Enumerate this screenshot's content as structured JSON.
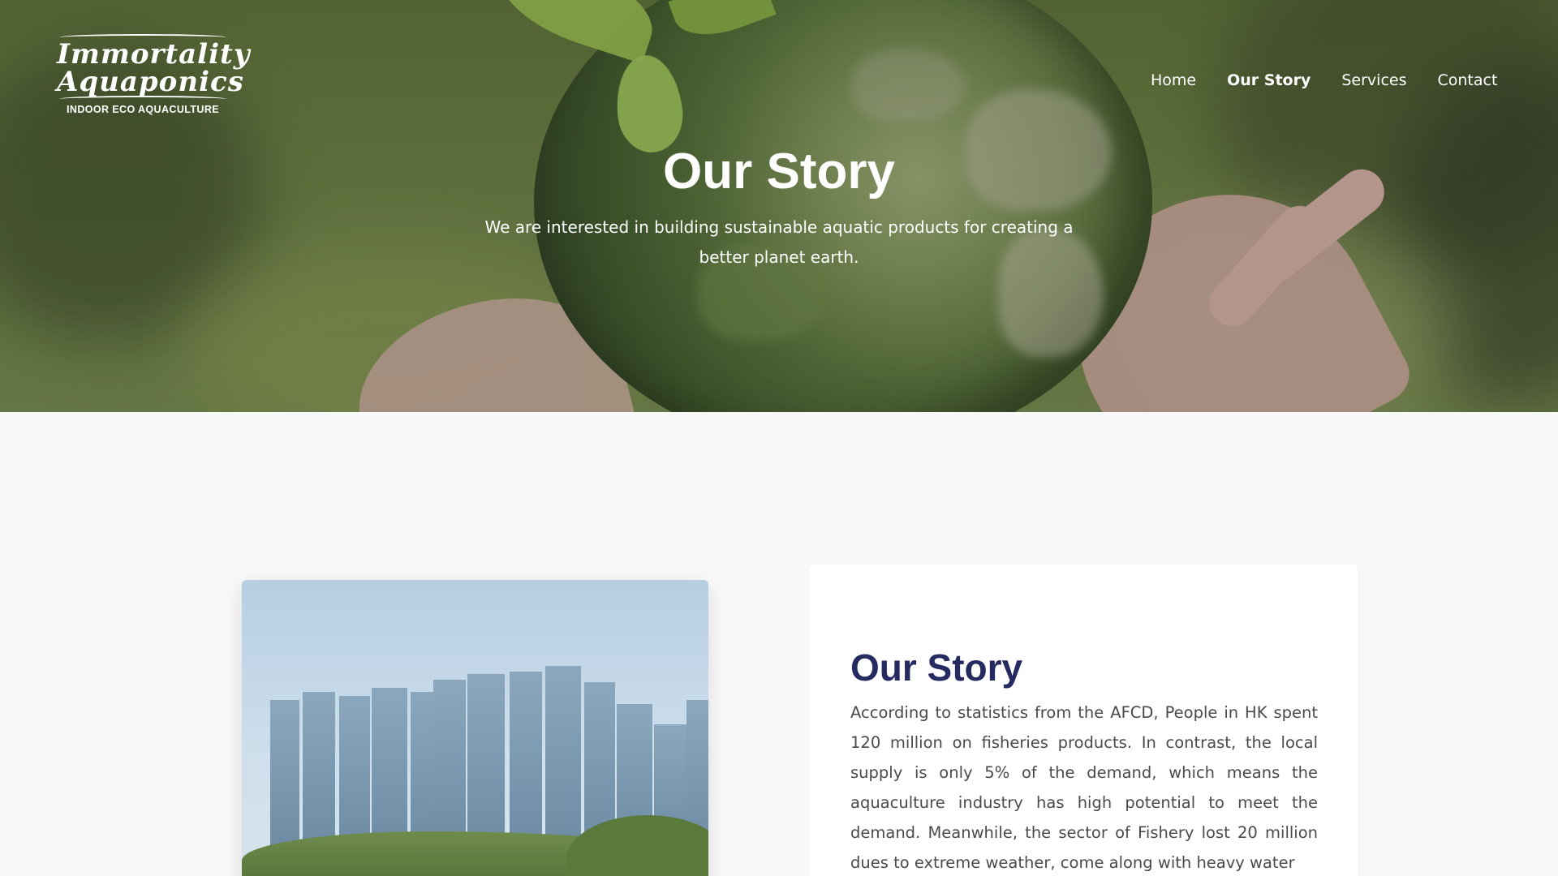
{
  "logo": {
    "line1": "Immortality",
    "line2": "Aquaponics",
    "tagline": "INDOOR ECO AQUACULTURE"
  },
  "nav": {
    "items": [
      {
        "label": "Home"
      },
      {
        "label": "Our Story"
      },
      {
        "label": "Services"
      },
      {
        "label": "Contact"
      }
    ],
    "active": "Our Story"
  },
  "hero": {
    "title": "Our Story",
    "subtitle": "We are interested in building sustainable aquatic products for creating a better planet earth."
  },
  "story": {
    "title": "Our Story",
    "body": "According to statistics from the AFCD, People in HK spent 120 million on fisheries products. In contrast, the local supply is only 5% of the demand, which means the aquaculture industry has high potential to meet the demand. Meanwhile, the sector of Fishery lost 20 million dues to extreme weather, come along with heavy water"
  },
  "colors": {
    "heading": "#252a60",
    "body_text": "#4a4a4a",
    "page_bg": "#f9f8f9"
  }
}
